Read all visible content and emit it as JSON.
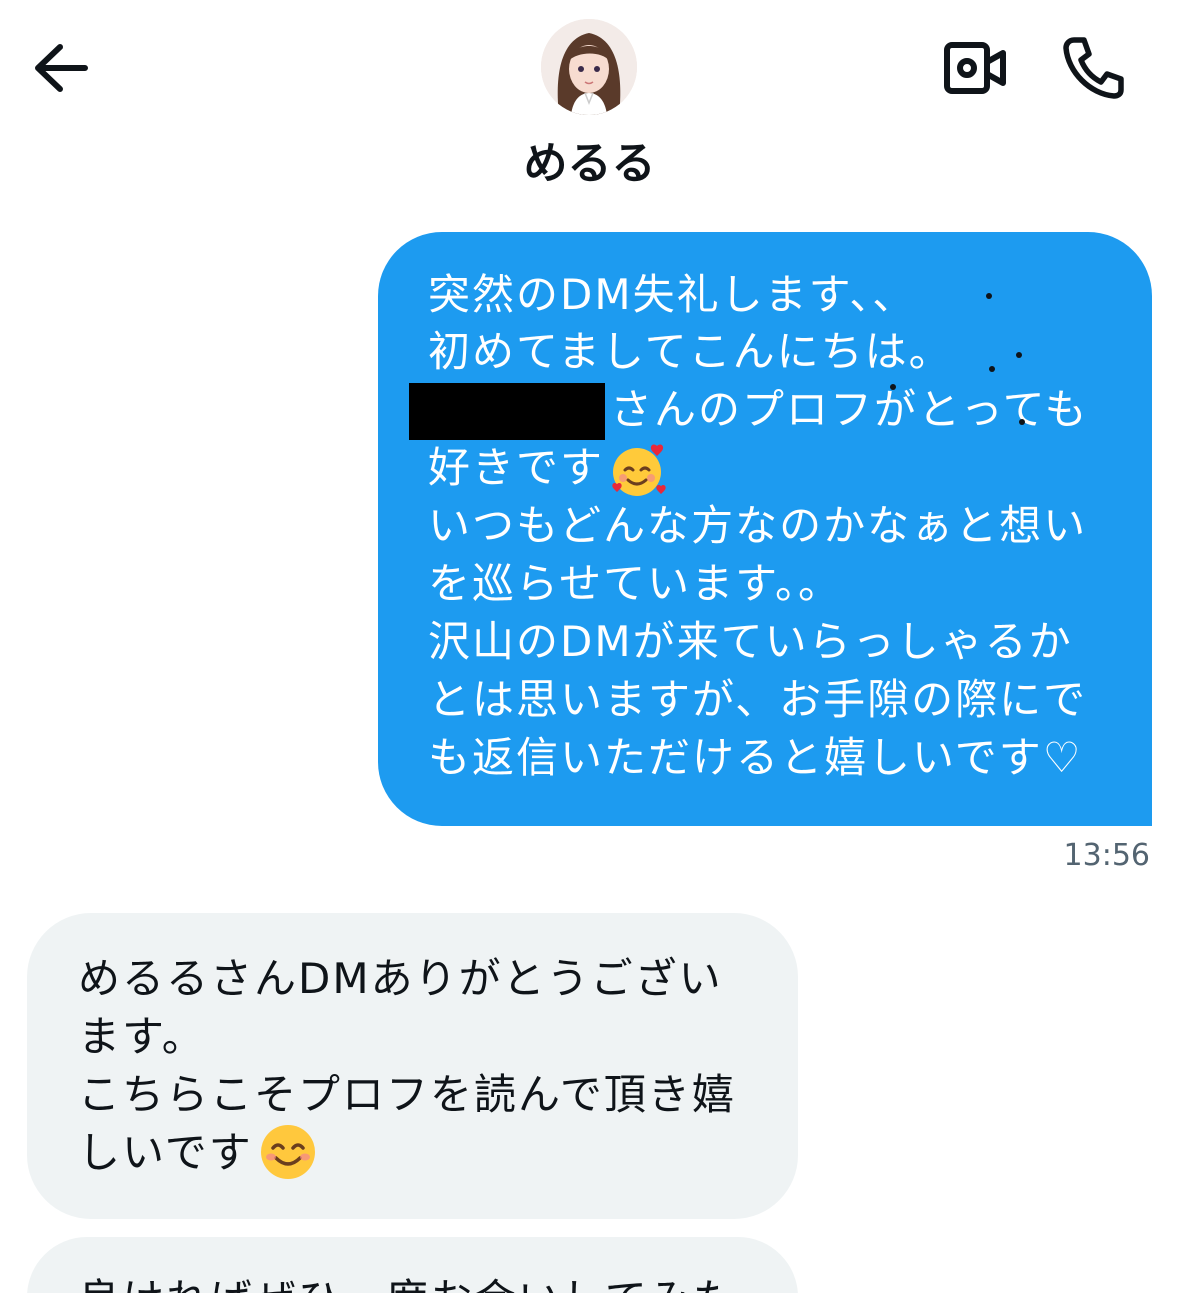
{
  "header": {
    "contact_name": "めるる",
    "back_icon": "arrow-left-icon",
    "video_icon": "video-call-icon",
    "phone_icon": "phone-icon"
  },
  "messages": [
    {
      "direction": "outgoing",
      "lines": [
        "突然のDM失礼します、、",
        "初めてましてこんにちは。",
        "さんのプロフがとっても",
        "好きです",
        "いつもどんな方なのかなぁと想い",
        "を巡らせています。。",
        "沢山のDMが来ていらっしゃるか",
        "とは思いますが、お手隙の際にで",
        "も返信いただけると嬉しいです♡"
      ],
      "emoji": "smiling-face-with-hearts",
      "redacted": true,
      "time": "13:56"
    },
    {
      "direction": "incoming",
      "lines": [
        "めるるさんDMありがとうござい",
        "ます。",
        "こちらこそプロフを読んで頂き嬉",
        "しいです"
      ],
      "emoji": "smiling-face-with-smiling-eyes"
    },
    {
      "direction": "incoming",
      "lines": [
        "良ければぜひ一度お会いしてみた"
      ]
    }
  ],
  "colors": {
    "outgoing_bubble": "#1d9bf0",
    "incoming_bubble": "#eff3f4",
    "text_dark": "#0f1419",
    "timestamp": "#536471"
  }
}
